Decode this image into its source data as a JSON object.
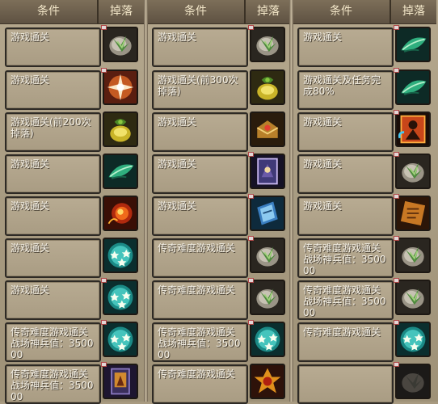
{
  "headers": {
    "condition": "条件",
    "drop": "掉落"
  },
  "columns": [
    {
      "rows": [
        {
          "condition": "游戏通关",
          "icon": "herb-icon",
          "tag": true
        },
        {
          "condition": "游戏通关",
          "icon": "starburst-icon",
          "tag": true
        },
        {
          "condition": "游戏通关(前200次掉落)",
          "icon": "gold-bag-icon",
          "tag": false
        },
        {
          "condition": "游戏通关",
          "icon": "green-leaf-icon",
          "tag": false
        },
        {
          "condition": "游戏通关",
          "icon": "fire-orb-icon",
          "tag": false
        },
        {
          "condition": "游戏通关",
          "icon": "star-orb-icon",
          "tag": false
        },
        {
          "condition": "游戏通关",
          "icon": "star-orb-icon",
          "tag": true
        },
        {
          "condition": "传奇难度游戏通关 战场神兵值：350000",
          "icon": "star-orb-icon",
          "tag": true
        },
        {
          "condition": "传奇难度游戏通关 战场神兵值：350000",
          "icon": "scroll-card-icon",
          "tag": true
        }
      ]
    },
    {
      "rows": [
        {
          "condition": "游戏通关",
          "icon": "herb-icon",
          "tag": true
        },
        {
          "condition": "游戏通关(前300次掉落)",
          "icon": "gold-bag-icon",
          "tag": false
        },
        {
          "condition": "游戏通关",
          "icon": "treasure-box-icon",
          "tag": false
        },
        {
          "condition": "游戏通关",
          "icon": "purple-card-icon",
          "tag": true
        },
        {
          "condition": "游戏通关",
          "icon": "blue-ticket-icon",
          "tag": true
        },
        {
          "condition": "传奇难度游戏通关",
          "icon": "herb-icon",
          "tag": true
        },
        {
          "condition": "传奇难度游戏通关",
          "icon": "herb-icon",
          "tag": true
        },
        {
          "condition": "传奇难度游戏通关 战场神兵值：350000",
          "icon": "star-orb-icon",
          "tag": true
        },
        {
          "condition": "传奇难度游戏通关",
          "icon": "golden-emblem-icon",
          "tag": false
        }
      ]
    },
    {
      "rows": [
        {
          "condition": "游戏通关",
          "icon": "green-leaf-icon",
          "tag": true
        },
        {
          "condition": "游戏通关及任务完成80%",
          "icon": "green-leaf-icon",
          "tag": true
        },
        {
          "condition": "游戏通关",
          "icon": "warrior-card-icon",
          "tag": true
        },
        {
          "condition": "游戏通关",
          "icon": "herb-icon",
          "tag": true
        },
        {
          "condition": "游戏通关",
          "icon": "orange-scroll-icon",
          "tag": true
        },
        {
          "condition": "传奇难度游戏通关 战场神兵值：350000",
          "icon": "herb-icon",
          "tag": true
        },
        {
          "condition": "传奇难度游戏通关 战场神兵值：350000",
          "icon": "herb-icon",
          "tag": true
        },
        {
          "condition": "传奇难度游戏通关",
          "icon": "star-orb-icon",
          "tag": true
        },
        {
          "condition": "",
          "icon": "dark-herb-icon",
          "tag": true
        }
      ]
    }
  ]
}
